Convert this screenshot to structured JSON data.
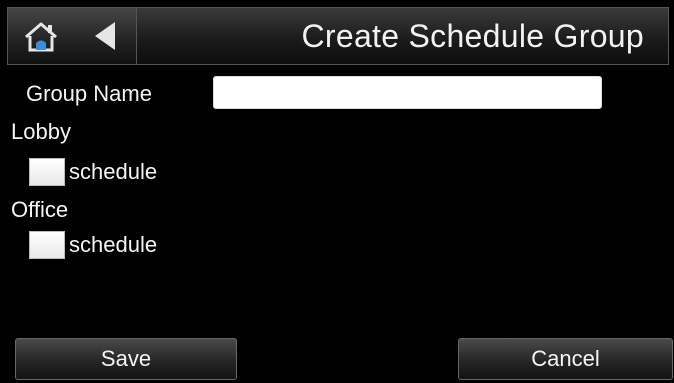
{
  "header": {
    "title": "Create Schedule Group",
    "home_icon": "home-icon",
    "back_icon": "back-arrow-icon"
  },
  "form": {
    "group_name_label": "Group Name",
    "group_name_value": "",
    "sections": [
      {
        "label": "Lobby",
        "checkbox_label": "schedule",
        "checked": false
      },
      {
        "label": "Office",
        "checkbox_label": "schedule",
        "checked": false
      }
    ]
  },
  "footer": {
    "save_label": "Save",
    "cancel_label": "Cancel"
  },
  "colors": {
    "background": "#000000",
    "accent_icon": "#3a8fd6",
    "text": "#f4f4f4"
  }
}
